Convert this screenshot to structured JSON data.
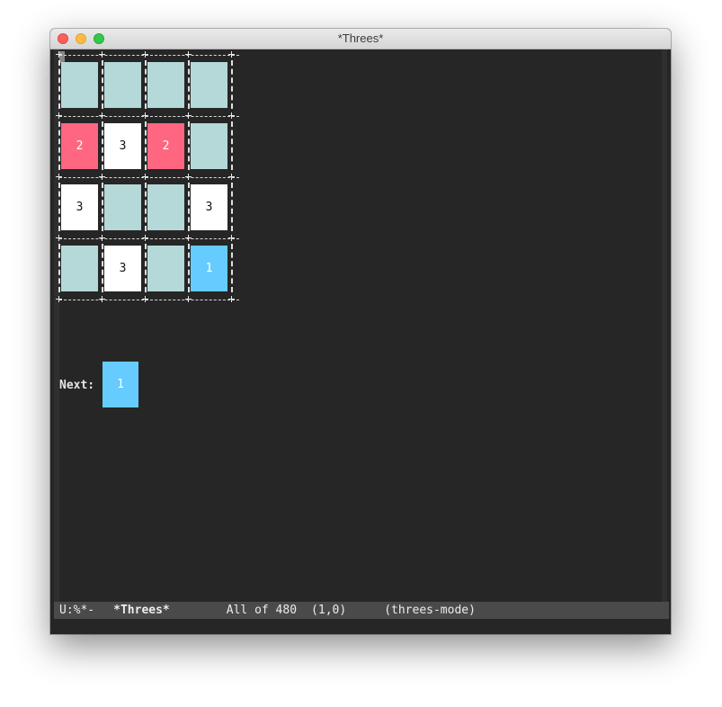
{
  "window": {
    "title": "*Threes*"
  },
  "board": {
    "rows": [
      [
        {
          "value": "",
          "color": "#b5d8d8"
        },
        {
          "value": "",
          "color": "#b5d8d8"
        },
        {
          "value": "",
          "color": "#b5d8d8"
        },
        {
          "value": "",
          "color": "#b5d8d8"
        }
      ],
      [
        {
          "value": "2",
          "color": "#ff6680"
        },
        {
          "value": "3",
          "color": "#ffffff"
        },
        {
          "value": "2",
          "color": "#ff6680"
        },
        {
          "value": "",
          "color": "#b5d8d8"
        }
      ],
      [
        {
          "value": "3",
          "color": "#ffffff"
        },
        {
          "value": "",
          "color": "#b5d8d8"
        },
        {
          "value": "",
          "color": "#b5d8d8"
        },
        {
          "value": "3",
          "color": "#ffffff"
        }
      ],
      [
        {
          "value": "",
          "color": "#b5d8d8"
        },
        {
          "value": "3",
          "color": "#ffffff"
        },
        {
          "value": "",
          "color": "#b5d8d8"
        },
        {
          "value": "1",
          "color": "#66ccff"
        }
      ]
    ]
  },
  "next": {
    "label": "Next:",
    "value": "1",
    "color": "#66ccff"
  },
  "modeline": {
    "status": "U:%*-",
    "buffer": "*Threes*",
    "position": "All of 480",
    "cursor": "(1,0)",
    "mode": "(threes-mode)"
  },
  "colors": {
    "background": "#262626",
    "empty_tile": "#b5d8d8",
    "two_tile": "#ff6680",
    "three_tile": "#ffffff",
    "one_tile": "#66ccff"
  }
}
